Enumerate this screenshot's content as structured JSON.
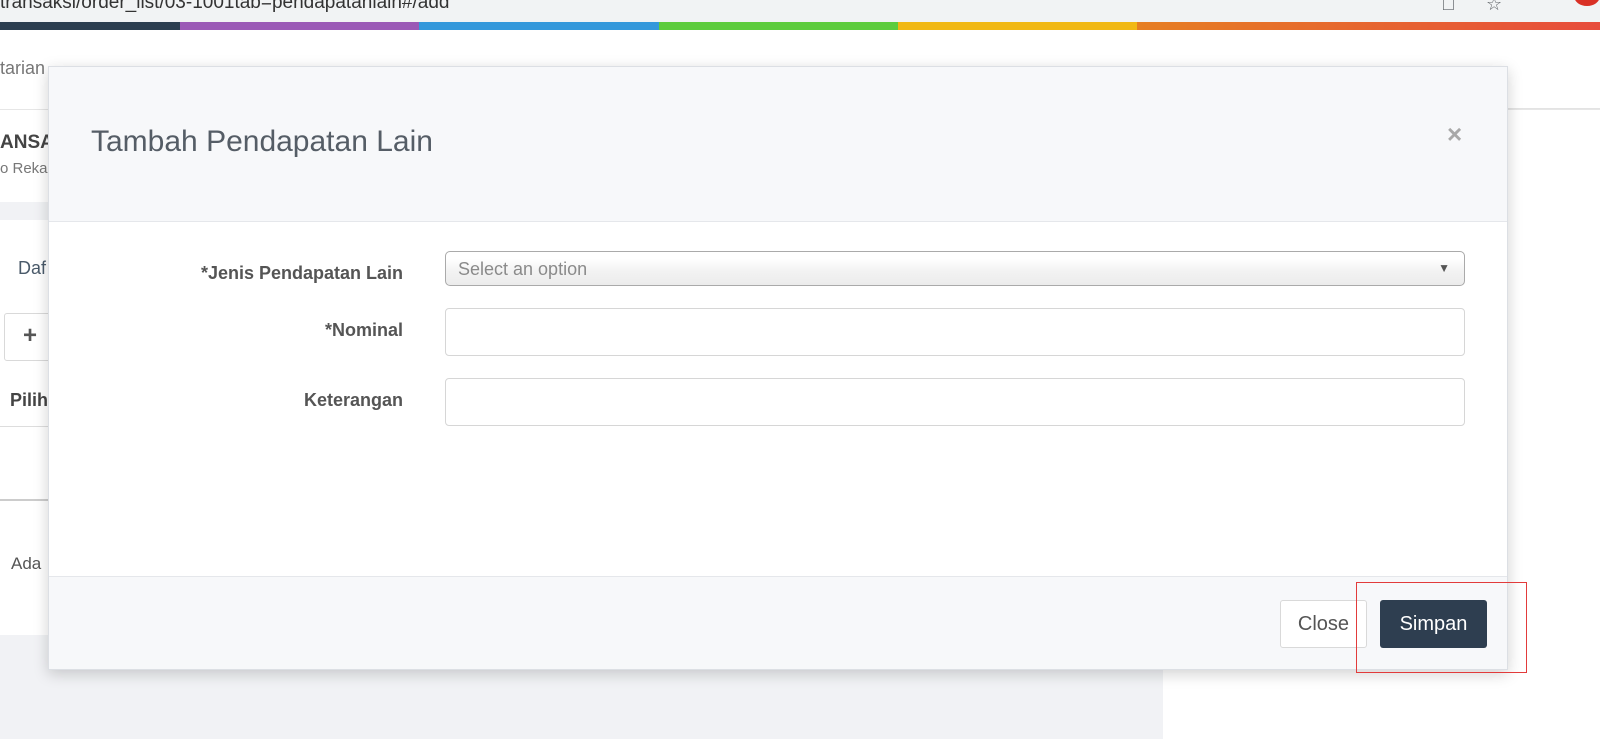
{
  "browser": {
    "url_fragment": "transaksi/order_list/03-1001tab=pendapatanlain#/add",
    "accent_strip": [
      "#2c3e50",
      "#9b59b6",
      "#3498db",
      "#5dcc3d",
      "#f1b814",
      "#e67e22"
    ]
  },
  "background_page": {
    "breadcrumb_fragment": "tarian",
    "title_fragment": "ANSA",
    "subtitle_fragment": "o Rekar",
    "tab_fragment": "Daf",
    "add_symbol": "+",
    "column_fragment": "Pilih",
    "row_fragment": "Ada"
  },
  "modal": {
    "title": "Tambah Pendapatan Lain",
    "close_symbol": "×",
    "fields": {
      "jenis": {
        "label": "*Jenis Pendapatan Lain",
        "placeholder": "Select an option"
      },
      "nominal": {
        "label": "*Nominal",
        "value": ""
      },
      "keterangan": {
        "label": "Keterangan",
        "value": ""
      }
    },
    "footer": {
      "close_label": "Close",
      "save_label": "Simpan"
    }
  },
  "colors": {
    "primary_button": "#2e3e50",
    "highlight_box": "#e23b3b"
  }
}
